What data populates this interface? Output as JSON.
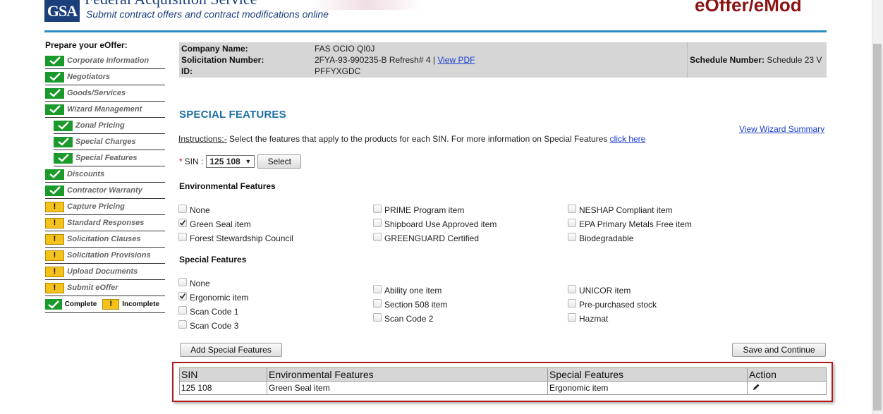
{
  "header": {
    "logo_text": "GSA",
    "agency_name": "Federal Acquisition Service",
    "tagline": "Submit contract offers and contract modifications online",
    "app_name": "eOffer/eMod"
  },
  "sidebar": {
    "title": "Prepare your eOffer:",
    "items": [
      {
        "label": "Corporate Information",
        "status": "complete",
        "sub": false
      },
      {
        "label": "Negotiators",
        "status": "complete",
        "sub": false
      },
      {
        "label": "Goods/Services",
        "status": "complete",
        "sub": false
      },
      {
        "label": "Wizard Management",
        "status": "complete",
        "sub": false
      },
      {
        "label": "Zonal Pricing",
        "status": "complete",
        "sub": true
      },
      {
        "label": "Special Charges",
        "status": "complete",
        "sub": true
      },
      {
        "label": "Special Features",
        "status": "complete",
        "sub": true
      },
      {
        "label": "Discounts",
        "status": "complete",
        "sub": false
      },
      {
        "label": "Contractor Warranty",
        "status": "complete",
        "sub": false
      },
      {
        "label": "Capture Pricing",
        "status": "incomplete",
        "sub": false
      },
      {
        "label": "Standard Responses",
        "status": "incomplete",
        "sub": false
      },
      {
        "label": "Solicitation Clauses",
        "status": "incomplete",
        "sub": false
      },
      {
        "label": "Solicitation Provisions",
        "status": "incomplete",
        "sub": false
      },
      {
        "label": "Upload Documents",
        "status": "incomplete",
        "sub": false
      },
      {
        "label": "Submit eOffer",
        "status": "incomplete",
        "sub": false
      }
    ],
    "legend": {
      "complete": "Complete",
      "incomplete": "Incomplete",
      "warn_glyph": "!"
    }
  },
  "company": {
    "name_label": "Company Name:",
    "name_value": "FAS OCIO QI0J",
    "solicitation_label": "Solicitation Number:",
    "solicitation_value": "2FYA-93-990235-B Refresh# 4 |",
    "view_pdf": "View PDF",
    "id_label": "ID:",
    "id_value": "PFFYXGDC",
    "schedule_label": "Schedule Number:",
    "schedule_value": "Schedule 23 V"
  },
  "main": {
    "title": "SPECIAL FEATURES",
    "wizard_link": "View Wizard Summary",
    "instructions_label": "Instructions:-",
    "instructions_text": " Select the features that apply to the products for each SIN. For more information on Special Features ",
    "instructions_link": "click here",
    "sin_required": "*",
    "sin_label": "SIN :",
    "sin_value": "125 108",
    "select_button": "Select",
    "environmental": {
      "title": "Environmental Features",
      "columns": [
        [
          {
            "label": "None",
            "checked": false
          },
          {
            "label": "Green Seal item",
            "checked": true
          },
          {
            "label": "Forest Stewardship Council",
            "checked": false
          }
        ],
        [
          {
            "label": "PRIME Program item",
            "checked": false
          },
          {
            "label": "Shipboard Use Approved item",
            "checked": false
          },
          {
            "label": "GREENGUARD Certified",
            "checked": false
          }
        ],
        [
          {
            "label": "NESHAP Compliant item",
            "checked": false
          },
          {
            "label": "EPA Primary Metals Free item",
            "checked": false
          },
          {
            "label": "Biodegradable",
            "checked": false
          }
        ]
      ]
    },
    "special": {
      "title": "Special Features",
      "columns": [
        [
          {
            "label": "None",
            "checked": false
          },
          {
            "label": "Ergonomic item",
            "checked": true
          },
          {
            "label": "Scan Code 1",
            "checked": false
          },
          {
            "label": "Scan Code 3",
            "checked": false
          }
        ],
        [
          {
            "label": "Ability one item",
            "checked": false
          },
          {
            "label": "Section 508 item",
            "checked": false
          },
          {
            "label": "Scan Code 2",
            "checked": false
          }
        ],
        [
          {
            "label": "UNICOR item",
            "checked": false
          },
          {
            "label": "Pre-purchased stock",
            "checked": false
          },
          {
            "label": "Hazmat",
            "checked": false
          }
        ]
      ]
    },
    "add_button": "Add Special Features",
    "save_button": "Save and Continue"
  },
  "results_table": {
    "headers": [
      "SIN",
      "Environmental Features",
      "Special Features",
      "Action"
    ],
    "rows": [
      {
        "sin": "125 108",
        "environmental": "Green Seal item",
        "special": "Ergonomic item"
      }
    ]
  },
  "colors": {
    "header_rule": "#2e8cc4",
    "app_name": "#8b1414",
    "section_title": "#1a6fa5",
    "complete": "#1b9a2c",
    "incomplete": "#f4c21a",
    "table_frame": "#b01c1c"
  }
}
